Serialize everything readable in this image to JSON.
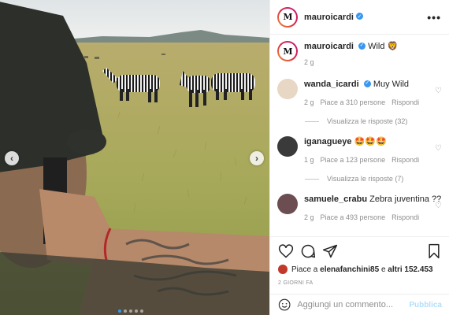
{
  "post": {
    "username": "mauroicardi",
    "avatar_text": "M",
    "more_label": "•••",
    "caption_user": "mauroicardi",
    "caption_text": "Wild 🦁",
    "caption_age": "2 g"
  },
  "comments": [
    {
      "user": "wanda_icardi",
      "verified": true,
      "text": "Muy Wild",
      "age": "2 g",
      "likes": "Piace a 310 persone",
      "reply": "Rispondi",
      "view_replies": "Visualizza le risposte (32)"
    },
    {
      "user": "iganagueye",
      "verified": false,
      "text": "🤩🤩🤩",
      "age": "1 g",
      "likes": "Piace a 123 persone",
      "reply": "Rispondi",
      "view_replies": "Visualizza le risposte (7)"
    },
    {
      "user": "samuele_crabu",
      "verified": false,
      "text": "Zebra juventina ??",
      "age": "2 g",
      "likes": "Piace a 493 persone",
      "reply": "Rispondi"
    }
  ],
  "actions": {
    "like_icon": "heart-icon",
    "comment_icon": "comment-icon",
    "share_icon": "send-icon",
    "save_icon": "bookmark-icon",
    "likes_prefix": "Piace a ",
    "likes_user": "elenafanchini85",
    "likes_mid": " e ",
    "likes_others": "altri 152.453",
    "date": "2 GIORNI FA"
  },
  "add_comment": {
    "placeholder": "Aggiungi un commento...",
    "emoji_icon": "smiley-icon",
    "publish_label": "Pubblica"
  },
  "photo": {
    "prev_label": "‹",
    "next_label": "›",
    "dots_count": 5,
    "active_dot": 0
  },
  "colors": {
    "accent": "#3897f0",
    "publish_disabled": "#b2dffc",
    "text": "#262626",
    "muted": "#8e8e8e"
  }
}
